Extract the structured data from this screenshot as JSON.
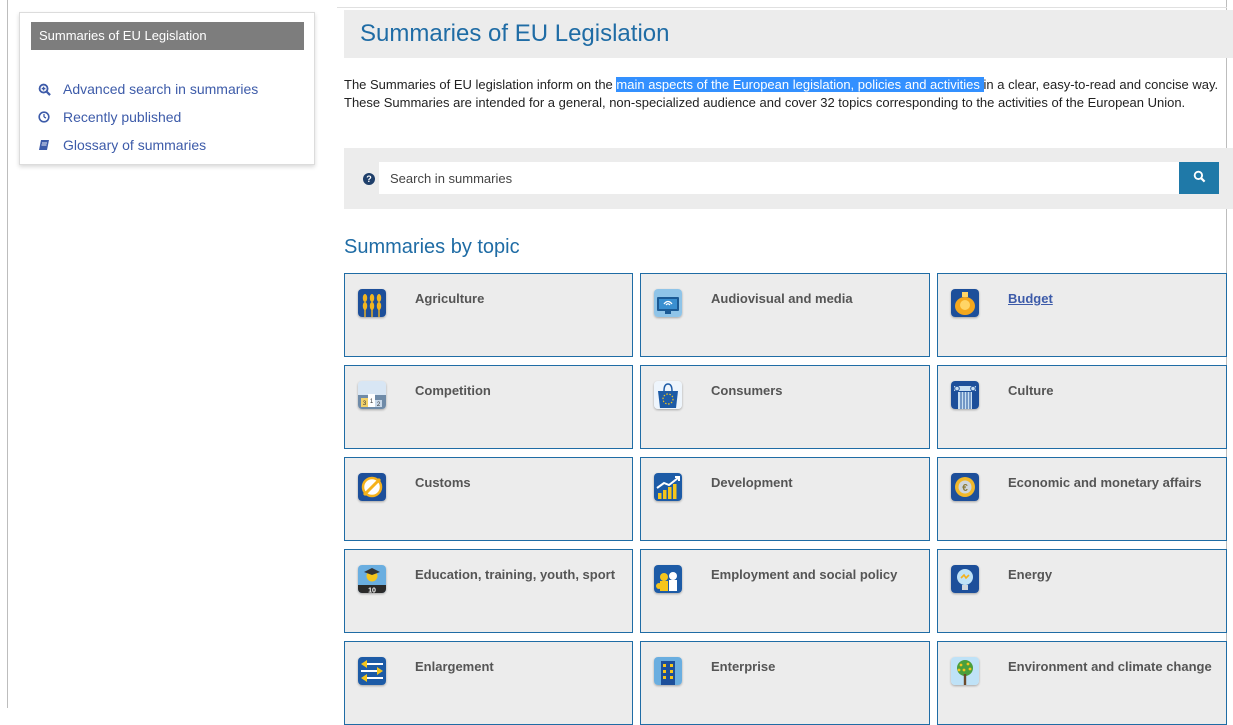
{
  "sidebar": {
    "header": "Summaries of EU Legislation",
    "items": [
      {
        "label": "Advanced search in summaries",
        "icon": "zoom-in-icon"
      },
      {
        "label": "Recently published",
        "icon": "clock-icon"
      },
      {
        "label": "Glossary of summaries",
        "icon": "book-icon"
      }
    ]
  },
  "main": {
    "title": "Summaries of EU Legislation",
    "intro": {
      "before": "The Summaries of EU legislation inform on the ",
      "highlight": "main aspects of the European legislation, policies and activities ",
      "after": "in a clear, easy-to-read and concise way. These Summaries are intended for a general, non-specialized audience and cover 32 topics corresponding to the activities of the European Union."
    },
    "search": {
      "placeholder": "Search in summaries",
      "help_icon": "question-circle-icon",
      "button_icon": "search-icon"
    },
    "section_title": "Summaries by topic",
    "topics": [
      {
        "label": "Agriculture",
        "icon": "agriculture-icon"
      },
      {
        "label": "Audiovisual and media",
        "icon": "audiovisual-icon"
      },
      {
        "label": "Budget",
        "icon": "budget-icon"
      },
      {
        "label": "Competition",
        "icon": "competition-icon"
      },
      {
        "label": "Consumers",
        "icon": "consumers-icon"
      },
      {
        "label": "Culture",
        "icon": "culture-icon"
      },
      {
        "label": "Customs",
        "icon": "customs-icon"
      },
      {
        "label": "Development",
        "icon": "development-icon"
      },
      {
        "label": "Economic and monetary affairs",
        "icon": "euro-coin-icon"
      },
      {
        "label": "Education, training, youth, sport",
        "icon": "education-icon"
      },
      {
        "label": "Employment and social policy",
        "icon": "employment-icon"
      },
      {
        "label": "Energy",
        "icon": "energy-icon"
      },
      {
        "label": "Enlargement",
        "icon": "enlargement-icon"
      },
      {
        "label": "Enterprise",
        "icon": "enterprise-icon"
      },
      {
        "label": "Environment and climate change",
        "icon": "environment-icon"
      }
    ]
  },
  "colors": {
    "accent": "#1f6ca5",
    "link": "#3d5ba9",
    "highlight": "#3390ff",
    "tile_bg": "#ececec",
    "search_button": "#1f79a8"
  }
}
